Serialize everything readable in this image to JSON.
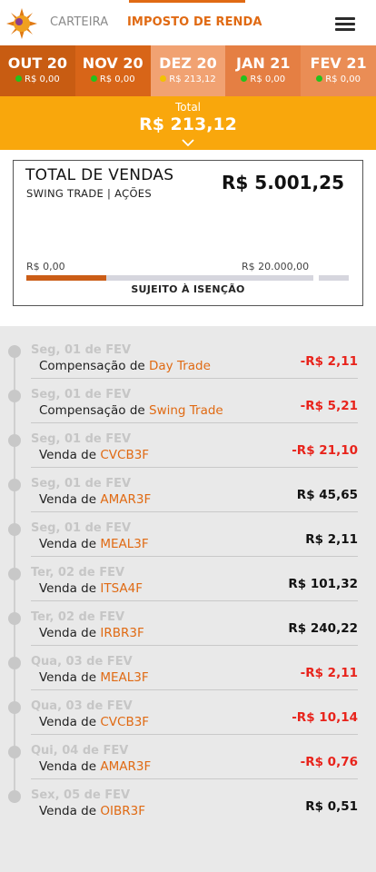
{
  "nav": {
    "carteira": "CARTEIRA",
    "imposto": "IMPOSTO DE RENDA"
  },
  "months": [
    {
      "label": "OUT 20",
      "value": "R$ 0,00",
      "status": "green"
    },
    {
      "label": "NOV 20",
      "value": "R$ 0,00",
      "status": "green"
    },
    {
      "label": "DEZ 20",
      "value": "R$ 213,12",
      "status": "yellow"
    },
    {
      "label": "JAN 21",
      "value": "R$ 0,00",
      "status": "green"
    },
    {
      "label": "FEV 21",
      "value": "R$ 0,00",
      "status": "green"
    }
  ],
  "total": {
    "label": "Total",
    "value": "R$ 213,12"
  },
  "sales": {
    "title": "TOTAL DE VENDAS",
    "subtitle": "SWING TRADE | AÇÕES",
    "amount": "R$ 5.001,25",
    "scale_min": "R$ 0,00",
    "scale_max": "R$ 20.000,00",
    "progress": 0.28,
    "footer": "SUJEITO À ISENÇÃO"
  },
  "entries": [
    {
      "date": "Seg, 01 de FEV",
      "prefix": "Compensação de ",
      "item": "Day Trade",
      "amount": "-R$ 2,11",
      "negative": true
    },
    {
      "date": "Seg, 01 de FEV",
      "prefix": "Compensação de ",
      "item": "Swing Trade",
      "amount": "-R$ 5,21",
      "negative": true
    },
    {
      "date": "Seg, 01 de FEV",
      "prefix": "Venda de ",
      "item": "CVCB3F",
      "amount": "-R$ 21,10",
      "negative": true
    },
    {
      "date": "Seg, 01 de FEV",
      "prefix": "Venda de ",
      "item": "AMAR3F",
      "amount": "R$ 45,65",
      "negative": false
    },
    {
      "date": "Seg, 01 de FEV",
      "prefix": "Venda de ",
      "item": "MEAL3F",
      "amount": "R$ 2,11",
      "negative": false
    },
    {
      "date": "Ter, 02 de FEV",
      "prefix": "Venda de ",
      "item": "ITSA4F",
      "amount": "R$ 101,32",
      "negative": false
    },
    {
      "date": "Ter, 02 de FEV",
      "prefix": "Venda de ",
      "item": "IRBR3F",
      "amount": "R$ 240,22",
      "negative": false
    },
    {
      "date": "Qua, 03 de FEV",
      "prefix": "Venda de ",
      "item": "MEAL3F",
      "amount": "-R$ 2,11",
      "negative": true
    },
    {
      "date": "Qua, 03 de FEV",
      "prefix": "Venda de ",
      "item": "CVCB3F",
      "amount": "-R$ 10,14",
      "negative": true
    },
    {
      "date": "Qui, 04 de FEV",
      "prefix": "Venda de ",
      "item": "AMAR3F",
      "amount": "-R$ 0,76",
      "negative": true
    },
    {
      "date": "Sex, 05 de FEV",
      "prefix": "Venda de ",
      "item": "OIBR3F",
      "amount": "R$ 0,51",
      "negative": false
    }
  ],
  "colors": {
    "accent": "#e06a13",
    "total_bar": "#f9a70c",
    "negative": "#e8231b"
  }
}
